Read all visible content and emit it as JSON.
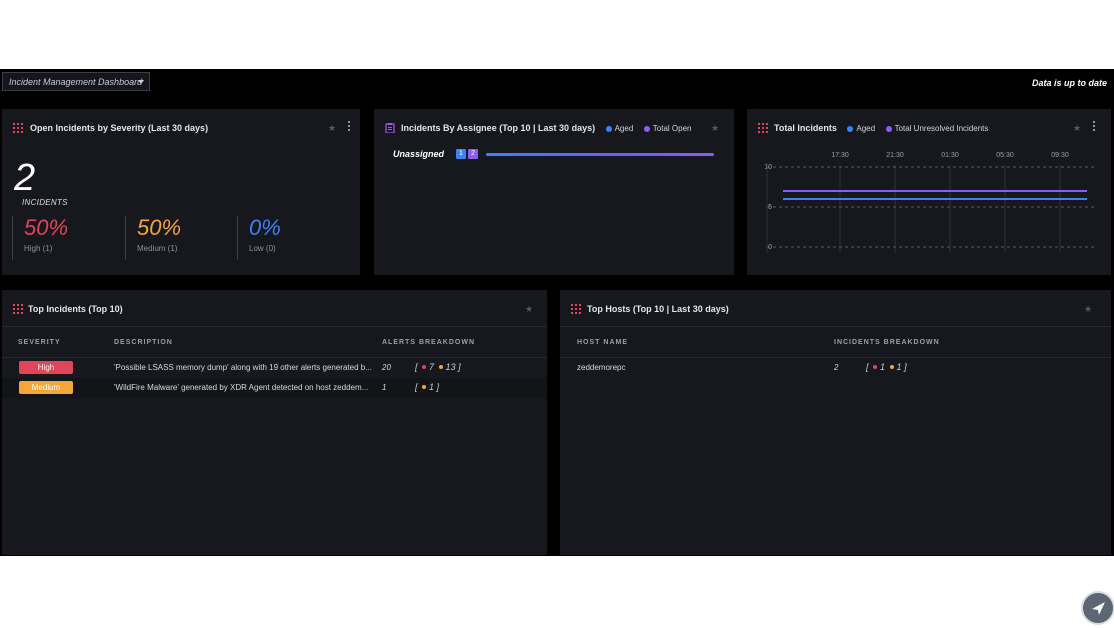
{
  "topbar": {
    "dashboard_select": "Incident Management Dashboard",
    "status": "Data is up to date"
  },
  "colors": {
    "high": "#e0455a",
    "medium": "#f5a63b",
    "low": "#3b82f6",
    "aged": "#3b82f6",
    "open": "#8b5cf6"
  },
  "panel_severity": {
    "title": "Open Incidents by Severity (Last 30 days)",
    "count": "2",
    "count_label": "INCIDENTS",
    "items": [
      {
        "pct": "50%",
        "label": "High (1)"
      },
      {
        "pct": "50%",
        "label": "Medium (1)"
      },
      {
        "pct": "0%",
        "label": "Low (0)"
      }
    ]
  },
  "panel_assignee": {
    "title": "Incidents By Assignee (Top 10 | Last 30 days)",
    "legend": [
      "Aged",
      "Total Open"
    ],
    "rows": [
      {
        "name": "Unassigned",
        "aged": "1",
        "open": "2"
      }
    ]
  },
  "panel_total": {
    "title": "Total Incidents",
    "legend": [
      "Aged",
      "Total Unresolved Incidents"
    ]
  },
  "chart_data": {
    "type": "line",
    "title": "Total Incidents",
    "x": [
      "17:30",
      "21:30",
      "01:30",
      "05:30",
      "09:30"
    ],
    "ylim": [
      0,
      10
    ],
    "yticks": [
      "10",
      "5",
      "0"
    ],
    "grid": true,
    "legend_position": "top",
    "series": [
      {
        "name": "Aged",
        "values": [
          6,
          6,
          6,
          6,
          6
        ]
      },
      {
        "name": "Total Unresolved Incidents",
        "values": [
          7,
          7,
          7,
          7,
          7
        ]
      }
    ]
  },
  "panel_top_incidents": {
    "title": "Top Incidents (Top 10)",
    "headers": [
      "SEVERITY",
      "DESCRIPTION",
      "ALERTS BREAKDOWN"
    ],
    "rows": [
      {
        "severity": "High",
        "description": "'Possible LSASS memory dump' along with 19 other alerts generated b...",
        "alerts": "20",
        "b1": "7",
        "b2": "13"
      },
      {
        "severity": "Medium",
        "description": "'WildFire Malware' generated by XDR Agent detected on host zeddem...",
        "alerts": "1",
        "b1": "1"
      }
    ]
  },
  "panel_top_hosts": {
    "title": "Top Hosts (Top 10 | Last 30 days)",
    "headers": [
      "HOST NAME",
      "INCIDENTS BREAKDOWN"
    ],
    "rows": [
      {
        "host": "zeddemorepc",
        "count": "2",
        "b1": "1",
        "b2": "1"
      }
    ]
  }
}
